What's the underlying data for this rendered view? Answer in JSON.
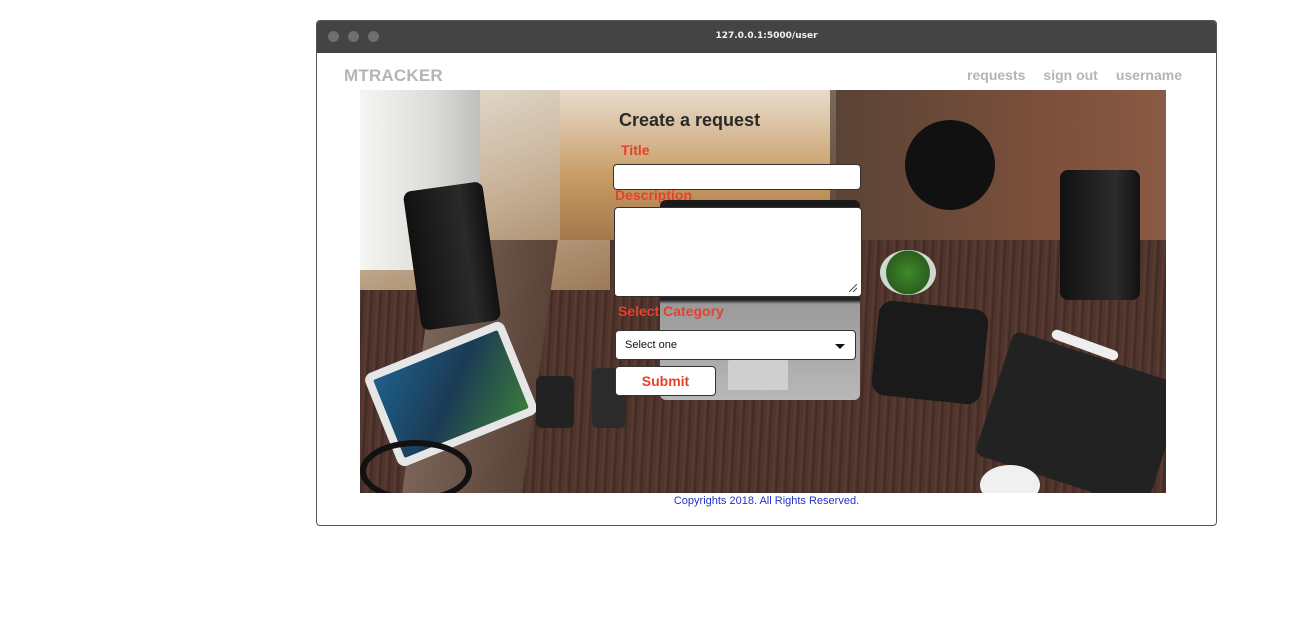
{
  "browser": {
    "url": "127.0.0.1:5000/user"
  },
  "navbar": {
    "brand": "MTRACKER",
    "links": [
      "requests",
      "sign out",
      "username"
    ]
  },
  "form": {
    "heading": "Create a request",
    "title_label": "Title",
    "title_value": "",
    "description_label": "Description",
    "description_value": "",
    "category_label": "Select Category",
    "category_selected": "Select one",
    "submit_label": "Submit"
  },
  "footer": {
    "text": "Copyrights  2018. All Rights Reserved."
  },
  "colors": {
    "label_red": "#e8402b",
    "footer_blue": "#2233cc",
    "nav_gray": "#b5b5b5",
    "titlebar": "#444444"
  }
}
